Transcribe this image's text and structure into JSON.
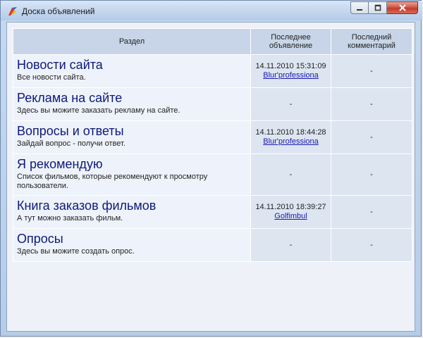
{
  "window": {
    "title": "Доска объявлений"
  },
  "columns": {
    "section": "Раздел",
    "last_post": "Последнее объявление",
    "last_comment": "Последний комментарий"
  },
  "rows": [
    {
      "title": "Новости сайта",
      "desc": "Все новости сайта.",
      "last_date": "14.11.2010 15:31:09",
      "last_author": "Blur'professiona",
      "last_comment": "-"
    },
    {
      "title": "Реклама на сайте",
      "desc": "Здесь вы можите заказать рекламу на сайте.",
      "last_date": "-",
      "last_author": "",
      "last_comment": "-"
    },
    {
      "title": "Вопросы и ответы",
      "desc": "Зайдай вопрос -  получи ответ.",
      "last_date": "14.11.2010 18:44:28",
      "last_author": "Blur'professiona",
      "last_comment": "-"
    },
    {
      "title": "Я рекомендую",
      "desc": "Список фильмов, которые рекомендуют к просмотру пользователи.",
      "last_date": "-",
      "last_author": "",
      "last_comment": "-"
    },
    {
      "title": "Книга заказов фильмов",
      "desc": "А тут можно заказать фильм.",
      "last_date": "14.11.2010 18:39:27",
      "last_author": "Golfimbul",
      "last_comment": "-"
    },
    {
      "title": "Опросы",
      "desc": "Здесь вы можите создать опрос.",
      "last_date": "-",
      "last_author": "",
      "last_comment": "-"
    }
  ]
}
